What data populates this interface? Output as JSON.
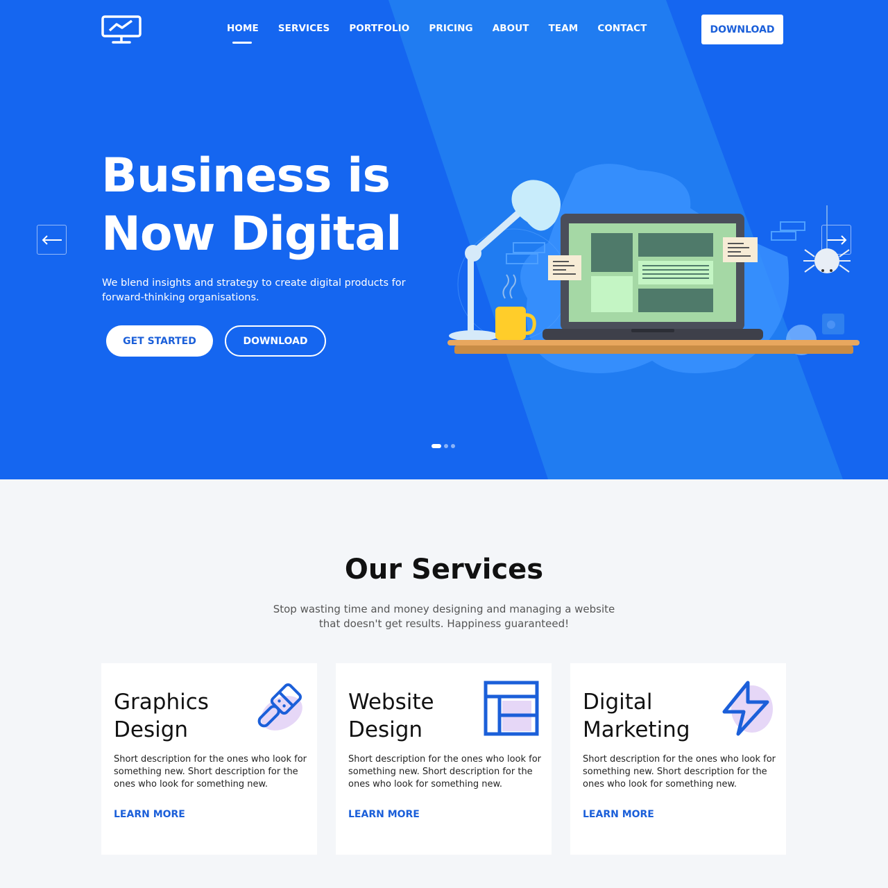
{
  "colors": {
    "brand": "#1566f0",
    "accent": "#1b5fd9",
    "background": "#f4f6f9"
  },
  "header": {
    "logo_icon": "monitor-chart-icon",
    "nav": [
      {
        "label": "HOME",
        "active": true
      },
      {
        "label": "SERVICES"
      },
      {
        "label": "PORTFOLIO"
      },
      {
        "label": "PRICING"
      },
      {
        "label": "ABOUT"
      },
      {
        "label": "TEAM"
      },
      {
        "label": "CONTACT"
      }
    ],
    "download_label": "DOWNLOAD"
  },
  "hero": {
    "title_line1": "Business is",
    "title_line2": "Now Digital",
    "subtitle": "We blend insights and strategy to create digital products for forward-thinking organisations.",
    "get_started_label": "GET STARTED",
    "download_label": "DOWNLOAD",
    "prev_icon": "arrow-left-icon",
    "next_icon": "arrow-right-icon",
    "slides_total": 3,
    "slide_active": 1
  },
  "services": {
    "title": "Our Services",
    "subtitle": "Stop wasting time and money designing and managing a website that doesn't get results. Happiness guaranteed!",
    "cards": [
      {
        "title": "Graphics Design",
        "icon": "paint-brush-icon",
        "description": "Short description for the ones who look for something new. Short description for the ones who look for something new.",
        "link": "LEARN MORE"
      },
      {
        "title": "Website Design",
        "icon": "layout-icon",
        "description": "Short description for the ones who look for something new. Short description for the ones who look for something new.",
        "link": "LEARN MORE"
      },
      {
        "title": "Digital Marketing",
        "icon": "lightning-icon",
        "description": "Short description for the ones who look for something new. Short description for the ones who look for something new.",
        "link": "LEARN MORE"
      }
    ]
  }
}
